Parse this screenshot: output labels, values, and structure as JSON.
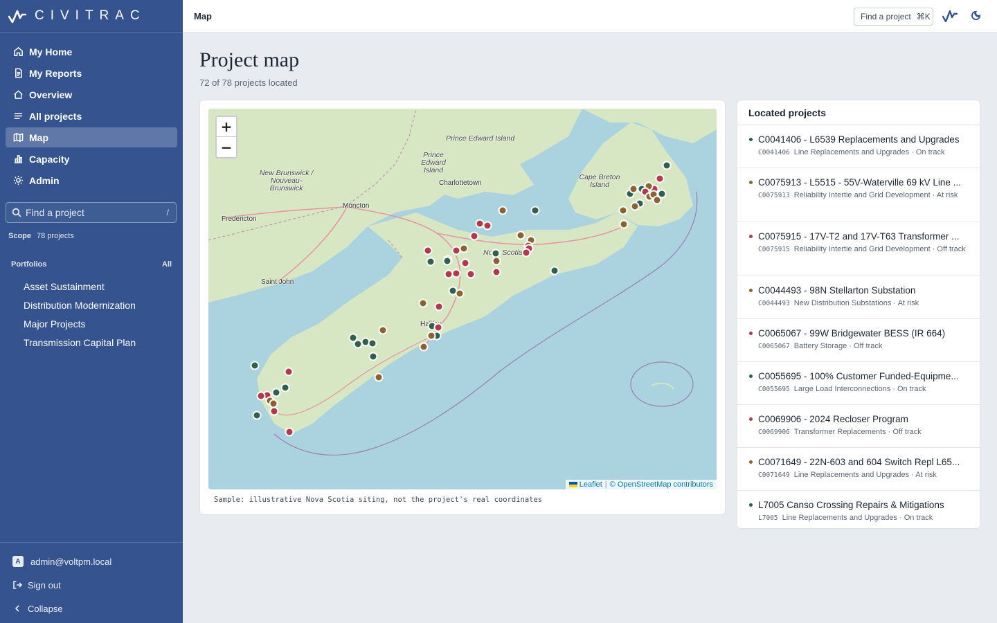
{
  "app": {
    "brand": "CIVITRAC",
    "page_header": "Map"
  },
  "topbar": {
    "find_label": "Find a project",
    "find_shortcut": "⌘K"
  },
  "sidebar": {
    "nav": [
      {
        "label": "My Home",
        "icon": "home-icon"
      },
      {
        "label": "My Reports",
        "icon": "document-icon"
      },
      {
        "label": "Overview",
        "icon": "home-outline-icon"
      },
      {
        "label": "All projects",
        "icon": "list-icon"
      },
      {
        "label": "Map",
        "icon": "map-icon",
        "active": true
      },
      {
        "label": "Capacity",
        "icon": "bar-chart-icon"
      },
      {
        "label": "Admin",
        "icon": "sun-gear-icon"
      }
    ],
    "search": {
      "placeholder": "Find a project",
      "shortcut": "/"
    },
    "scope": {
      "label": "Scope",
      "value": "78 projects"
    },
    "portfolios": {
      "heading": "Portfolios",
      "all_label": "All",
      "items": [
        "Asset Sustainment",
        "Distribution Modernization",
        "Major Projects",
        "Transmission Capital Plan"
      ]
    },
    "footer": {
      "user": "admin@voltpm.local",
      "avatar": "A",
      "sign_out": "Sign out",
      "collapse": "Collapse"
    }
  },
  "page": {
    "title": "Project map",
    "subtitle": "72 of 78 projects located"
  },
  "map": {
    "zoom_in": "+",
    "zoom_out": "−",
    "attribution": {
      "leaflet": "Leaflet",
      "separator": "|",
      "osm": "© OpenStreetMap contributors"
    },
    "note": "Sample: illustrative Nova Scotia siting, not the project's real coordinates",
    "places": [
      "Prince Edward Island",
      "Prince Edward Island",
      "Charlottetown",
      "New Brunswick / Nouveau-Brunswick",
      "Moncton",
      "Fredericton",
      "Saint John",
      "Cape Breton Island",
      "Nova Scotia",
      "Halifax"
    ],
    "status_colors": {
      "on_track": "#2f5f4d",
      "at_risk": "#8a6430",
      "off_track": "#b03a48"
    }
  },
  "located": {
    "heading": "Located projects",
    "items": [
      {
        "name": "C0041406 - L6539 Replacements and Upgrades",
        "code": "C0041406",
        "portfolio": "Line Replacements and Upgrades",
        "status": "On track",
        "color": "#2f5f4d"
      },
      {
        "name": "C0075913 - L5515 - 55V-Waterville 69 kV Line ...",
        "code": "C0075913",
        "portfolio": "Reliability Intertie and Grid Development",
        "status": "At risk",
        "color": "#8a6430"
      },
      {
        "name": "C0075915 - 17V-T2 and 17V-T63 Transformer ...",
        "code": "C0075915",
        "portfolio": "Reliability Intertie and Grid Development",
        "status": "Off track",
        "color": "#b03a48"
      },
      {
        "name": "C0044493 - 98N Stellarton Substation",
        "code": "C0044493",
        "portfolio": "New Distribution Substations",
        "status": "At risk",
        "color": "#8a6430"
      },
      {
        "name": "C0065067 - 99W Bridgewater BESS (IR 664)",
        "code": "C0065067",
        "portfolio": "Battery Storage",
        "status": "Off track",
        "color": "#b03a48"
      },
      {
        "name": "C0055695 - 100% Customer Funded-Equipme...",
        "code": "C0055695",
        "portfolio": "Large Load Interconnections",
        "status": "On track",
        "color": "#2f5f4d"
      },
      {
        "name": "C0069906 - 2024 Recloser Program",
        "code": "C0069906",
        "portfolio": "Transformer Replacements",
        "status": "Off track",
        "color": "#b03a48"
      },
      {
        "name": "C0071649 - 22N-603 and 604 Switch Repl L65...",
        "code": "C0071649",
        "portfolio": "Line Replacements and Upgrades",
        "status": "At risk",
        "color": "#8a6430"
      },
      {
        "name": "L7005 Canso Crossing Repairs & Mitigations",
        "code": "L7005",
        "portfolio": "Line Replacements and Upgrades",
        "status": "On track",
        "color": "#2f5f4d"
      }
    ]
  }
}
